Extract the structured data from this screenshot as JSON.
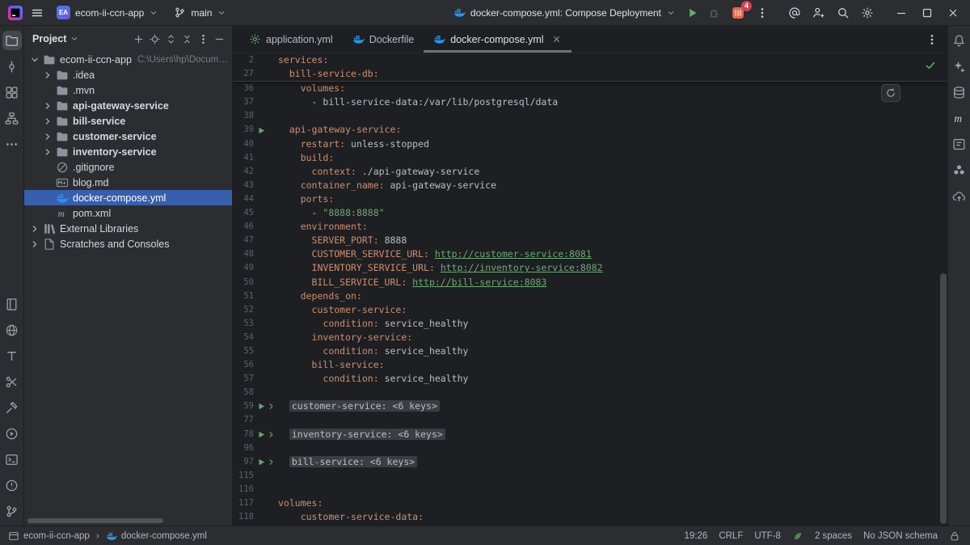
{
  "colors": {
    "accent_blue": "#3574F0",
    "selection_blue": "#375FAD",
    "docker_blue": "#2396ED",
    "run_green": "#5FAD65",
    "yaml_key_orange": "#CF8E6D",
    "string_green": "#6AAB73",
    "badge_red": "#D6414F"
  },
  "titlebar": {
    "project_badge": "EA",
    "project_name": "ecom-ii-ccn-app",
    "branch_name": "main",
    "run_config_label": "docker-compose.yml: Compose Deployment",
    "services_badge_count": "4",
    "actions": [
      {
        "name": "mentions",
        "icon": "at"
      },
      {
        "name": "code-with-me",
        "icon": "user-plus"
      },
      {
        "name": "search-everywhere",
        "icon": "search"
      },
      {
        "name": "settings",
        "icon": "gear"
      }
    ],
    "window_controls": [
      {
        "name": "minimize",
        "icon": "minimize"
      },
      {
        "name": "maximize",
        "icon": "maximize"
      },
      {
        "name": "close",
        "icon": "close"
      }
    ]
  },
  "left_stripe": {
    "top": [
      {
        "name": "project",
        "icon": "folder-tool",
        "active": true
      },
      {
        "name": "commit",
        "icon": "commit"
      },
      {
        "name": "structure",
        "icon": "structure"
      },
      {
        "name": "hierarchy",
        "icon": "hierarchy"
      },
      {
        "name": "more-toolwindows",
        "icon": "more"
      }
    ],
    "bottom": [
      {
        "name": "services",
        "icon": "book"
      },
      {
        "name": "endpoints",
        "icon": "globe"
      },
      {
        "name": "todo",
        "icon": "todo"
      },
      {
        "name": "git-tools",
        "icon": "scissors"
      },
      {
        "name": "build",
        "icon": "hammer"
      },
      {
        "name": "profiler",
        "icon": "profiler"
      },
      {
        "name": "terminal",
        "icon": "terminal"
      },
      {
        "name": "problems",
        "icon": "problems"
      },
      {
        "name": "version-control",
        "icon": "branch-tool"
      }
    ]
  },
  "right_stripe": [
    {
      "name": "notifications",
      "icon": "bell"
    },
    {
      "name": "ai-assistant",
      "icon": "sparkle"
    },
    {
      "name": "database",
      "icon": "database"
    },
    {
      "name": "maven",
      "icon": "maven-tool"
    },
    {
      "name": "dependencies",
      "icon": "board"
    },
    {
      "name": "plugins",
      "icon": "flower"
    },
    {
      "name": "remote",
      "icon": "cloud"
    }
  ],
  "project_panel": {
    "title": "Project",
    "header_icons": [
      {
        "name": "new-item",
        "icon": "plus"
      },
      {
        "name": "locate-file",
        "icon": "target"
      },
      {
        "name": "expand-all",
        "icon": "expand"
      },
      {
        "name": "collapse-all",
        "icon": "collapse"
      },
      {
        "name": "more-options",
        "icon": "kebab"
      },
      {
        "name": "hide-panel",
        "icon": "minus"
      }
    ],
    "tree": [
      {
        "label": "ecom-ii-ccn-app",
        "suffix": "C:\\Users\\hp\\Documents\\p",
        "icon": "folder",
        "chevron": "down",
        "level": 0
      },
      {
        "label": ".idea",
        "icon": "folder",
        "chevron": "right",
        "level": 1
      },
      {
        "label": ".mvn",
        "icon": "folder",
        "chevron": "none",
        "level": 1
      },
      {
        "label": "api-gateway-service",
        "icon": "folder",
        "chevron": "right",
        "level": 1,
        "bold": true
      },
      {
        "label": "bill-service",
        "icon": "folder",
        "chevron": "right",
        "level": 1,
        "bold": true
      },
      {
        "label": "customer-service",
        "icon": "folder",
        "chevron": "right",
        "level": 1,
        "bold": true
      },
      {
        "label": "inventory-service",
        "icon": "folder",
        "chevron": "right",
        "level": 1,
        "bold": true
      },
      {
        "label": ".gitignore",
        "icon": "ignore",
        "chevron": "none",
        "level": 1
      },
      {
        "label": "blog.md",
        "icon": "markdown",
        "chevron": "none",
        "level": 1
      },
      {
        "label": "docker-compose.yml",
        "icon": "docker",
        "chevron": "none",
        "level": 1,
        "selected": true
      },
      {
        "label": "pom.xml",
        "icon": "maven",
        "chevron": "none",
        "level": 1
      },
      {
        "label": "External Libraries",
        "icon": "library",
        "chevron": "right",
        "level": 0
      },
      {
        "label": "Scratches and Consoles",
        "icon": "scratch",
        "chevron": "right",
        "level": 0
      }
    ]
  },
  "editor": {
    "tabs": [
      {
        "label": "application.yml",
        "icon": "spring-gear"
      },
      {
        "label": "Dockerfile",
        "icon": "docker"
      },
      {
        "label": "docker-compose.yml",
        "icon": "docker",
        "active": true
      }
    ],
    "sticky_lines": [
      {
        "num": "2",
        "indent": 0,
        "tokens": [
          {
            "c": "key",
            "t": "services:"
          }
        ]
      },
      {
        "num": "27",
        "indent": 2,
        "tokens": [
          {
            "c": "key",
            "t": "bill-service-db:"
          }
        ]
      }
    ],
    "lines": [
      {
        "num": "36",
        "indent": 4,
        "tokens": [
          {
            "c": "key",
            "t": "volumes:"
          }
        ]
      },
      {
        "num": "37",
        "indent": 6,
        "tokens": [
          {
            "c": "plain",
            "t": "- bill-service-data:/var/lib/postgresql/data"
          }
        ]
      },
      {
        "num": "38",
        "indent": 0,
        "tokens": []
      },
      {
        "num": "39",
        "indent": 2,
        "run": true,
        "tokens": [
          {
            "c": "key",
            "t": "api-gateway-service:"
          }
        ]
      },
      {
        "num": "40",
        "indent": 4,
        "tokens": [
          {
            "c": "key",
            "t": "restart:"
          },
          {
            "c": "plain",
            "t": " unless-stopped"
          }
        ]
      },
      {
        "num": "41",
        "indent": 4,
        "tokens": [
          {
            "c": "key",
            "t": "build:"
          }
        ]
      },
      {
        "num": "42",
        "indent": 6,
        "tokens": [
          {
            "c": "key",
            "t": "context:"
          },
          {
            "c": "plain",
            "t": " ./api-gateway-service"
          }
        ]
      },
      {
        "num": "43",
        "indent": 4,
        "tokens": [
          {
            "c": "key",
            "t": "container_name:"
          },
          {
            "c": "plain",
            "t": " api-gateway-service"
          }
        ]
      },
      {
        "num": "44",
        "indent": 4,
        "tokens": [
          {
            "c": "key",
            "t": "ports:"
          }
        ]
      },
      {
        "num": "45",
        "indent": 6,
        "tokens": [
          {
            "c": "plain",
            "t": "- "
          },
          {
            "c": "string",
            "t": "\"8888:8888\""
          }
        ]
      },
      {
        "num": "46",
        "indent": 4,
        "tokens": [
          {
            "c": "key",
            "t": "environment:"
          }
        ]
      },
      {
        "num": "47",
        "indent": 6,
        "tokens": [
          {
            "c": "key",
            "t": "SERVER_PORT:"
          },
          {
            "c": "plain",
            "t": " 8888"
          }
        ]
      },
      {
        "num": "48",
        "indent": 6,
        "tokens": [
          {
            "c": "key",
            "t": "CUSTOMER_SERVICE_URL:"
          },
          {
            "c": "plain",
            "t": " "
          },
          {
            "c": "link",
            "t": "http://customer-service:8081"
          }
        ]
      },
      {
        "num": "49",
        "indent": 6,
        "tokens": [
          {
            "c": "key",
            "t": "INVENTORY_SERVICE_URL:"
          },
          {
            "c": "plain",
            "t": " "
          },
          {
            "c": "link",
            "t": "http://inventory-service:8082"
          }
        ]
      },
      {
        "num": "50",
        "indent": 6,
        "tokens": [
          {
            "c": "key",
            "t": "BILL_SERVICE_URL:"
          },
          {
            "c": "plain",
            "t": " "
          },
          {
            "c": "link",
            "t": "http://bill-service:8083"
          }
        ]
      },
      {
        "num": "51",
        "indent": 4,
        "tokens": [
          {
            "c": "key",
            "t": "depends_on:"
          }
        ]
      },
      {
        "num": "52",
        "indent": 6,
        "tokens": [
          {
            "c": "key",
            "t": "customer-service:"
          }
        ]
      },
      {
        "num": "53",
        "indent": 8,
        "tokens": [
          {
            "c": "key",
            "t": "condition:"
          },
          {
            "c": "plain",
            "t": " service_healthy"
          }
        ]
      },
      {
        "num": "54",
        "indent": 6,
        "tokens": [
          {
            "c": "key",
            "t": "inventory-service:"
          }
        ]
      },
      {
        "num": "55",
        "indent": 8,
        "tokens": [
          {
            "c": "key",
            "t": "condition:"
          },
          {
            "c": "plain",
            "t": " service_healthy"
          }
        ]
      },
      {
        "num": "56",
        "indent": 6,
        "tokens": [
          {
            "c": "key",
            "t": "bill-service:"
          }
        ]
      },
      {
        "num": "57",
        "indent": 8,
        "tokens": [
          {
            "c": "key",
            "t": "condition:"
          },
          {
            "c": "plain",
            "t": " service_healthy"
          }
        ]
      },
      {
        "num": "58",
        "indent": 0,
        "tokens": []
      },
      {
        "num": "59",
        "indent": 2,
        "run": true,
        "fold": true,
        "tokens": [
          {
            "c": "folded",
            "t": "customer-service: <6 keys>"
          }
        ]
      },
      {
        "num": "77",
        "indent": 0,
        "tokens": []
      },
      {
        "num": "78",
        "indent": 2,
        "run": true,
        "fold": true,
        "tokens": [
          {
            "c": "folded",
            "t": "inventory-service: <6 keys>"
          }
        ]
      },
      {
        "num": "96",
        "indent": 0,
        "tokens": []
      },
      {
        "num": "97",
        "indent": 2,
        "run": true,
        "fold": true,
        "tokens": [
          {
            "c": "folded",
            "t": "bill-service: <6 keys>"
          }
        ]
      },
      {
        "num": "115",
        "indent": 0,
        "tokens": []
      },
      {
        "num": "116",
        "indent": 0,
        "tokens": []
      },
      {
        "num": "117",
        "indent": 0,
        "tokens": [
          {
            "c": "key",
            "t": "volumes:"
          }
        ]
      },
      {
        "num": "118",
        "indent": 4,
        "tokens": [
          {
            "c": "key",
            "t": "customer-service-data:"
          }
        ]
      }
    ]
  },
  "status_bar": {
    "breadcrumb": {
      "project": "ecom-ii-ccn-app",
      "file": "docker-compose.yml"
    },
    "caret": "19:26",
    "line_separator": "CRLF",
    "encoding": "UTF-8",
    "indent": "2 spaces",
    "schema": "No JSON schema"
  }
}
